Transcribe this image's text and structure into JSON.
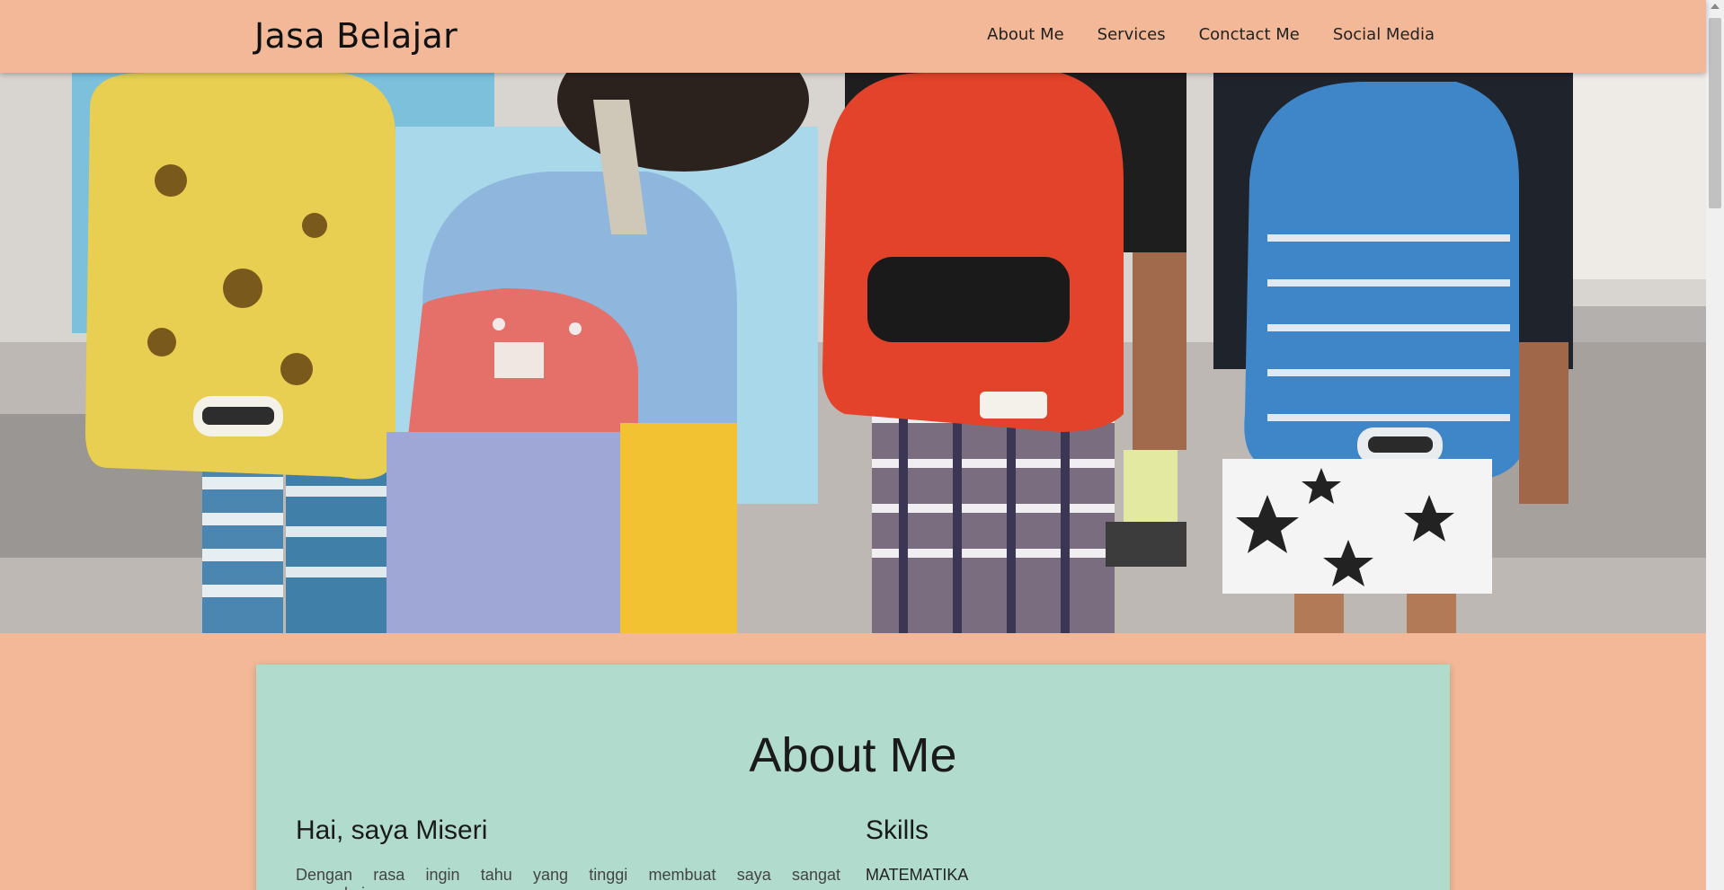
{
  "navbar": {
    "brand": "Jasa Belajar",
    "links": [
      "About Me",
      "Services",
      "Conctact Me",
      "Social Media"
    ]
  },
  "hero": {
    "image": "photo of children wearing colorful backpacks walking"
  },
  "about": {
    "title": "About Me",
    "intro_heading": "Hai, saya Miseri",
    "intro_text": "Dengan rasa ingin tahu yang tinggi membuat saya sangat menyukai",
    "skills_heading": "Skills",
    "skills": [
      "MATEMATIKA"
    ]
  },
  "colors": {
    "background": "#f2b898",
    "card": "#b1dccd"
  }
}
